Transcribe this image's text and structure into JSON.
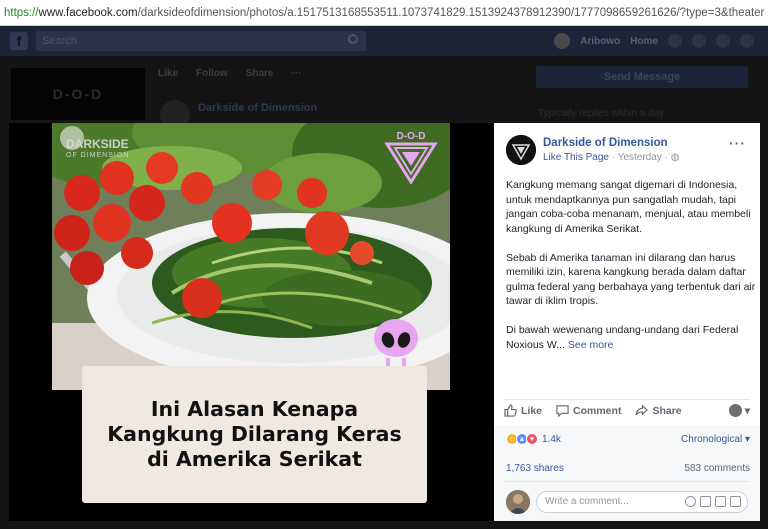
{
  "browser": {
    "url_protocol": "https://",
    "url_host": "www.facebook.com",
    "url_path": "/darksideofdimension/photos/a.1517513168553511.1073741829.1513924378912390/1777098659261626/?type=3&theater"
  },
  "fb_header": {
    "search_placeholder": "Search",
    "user_name": "Aribowo",
    "home_label": "Home"
  },
  "background_page": {
    "cover_text": "D-O-D",
    "tabs": [
      "Like",
      "Follow",
      "Share",
      "···"
    ],
    "send_message": "Send Message",
    "post_author": "Darkside of Dimension",
    "side_text": "Typically replies within a day"
  },
  "photo": {
    "watermark": "DARKSIDE",
    "watermark_sub": "OF DIMENSION",
    "logo_text": "D-O-D",
    "caption": "Ini Alasan Kenapa\nKangkung Dilarang Keras\ndi Amerika Serikat"
  },
  "post": {
    "page_name": "Darkside of Dimension",
    "like_page": "Like This Page",
    "time": "Yesterday",
    "more": "···",
    "paragraphs": [
      "Kangkung memang sangat digemari di Indonesia, untuk mendaptkannya pun sangatlah mudah, tapi jangan coba-coba menanam, menjual, atau membeli kangkung di Amerika Serikat.",
      "Sebab di Amerika tanaman ini dilarang dan harus memiliki izin, karena kangkung berada dalam daftar gulma federal yang berbahaya yang terbentuk dari air tawar di iklim tropis."
    ],
    "last_paragraph": "Di bawah wewenang undang-undang dari Federal Noxious W...",
    "see_more": "See more",
    "actions": {
      "like": "Like",
      "comment": "Comment",
      "share": "Share"
    },
    "reactions_count": "1.4k",
    "sort": "Chronological",
    "shares": "1,763 shares",
    "comments": "583 comments",
    "comment_placeholder": "Write a comment..."
  },
  "colors": {
    "fb_blue": "#365899",
    "card_bg": "#efe9e2",
    "logo_pink": "#e7a6ef"
  }
}
